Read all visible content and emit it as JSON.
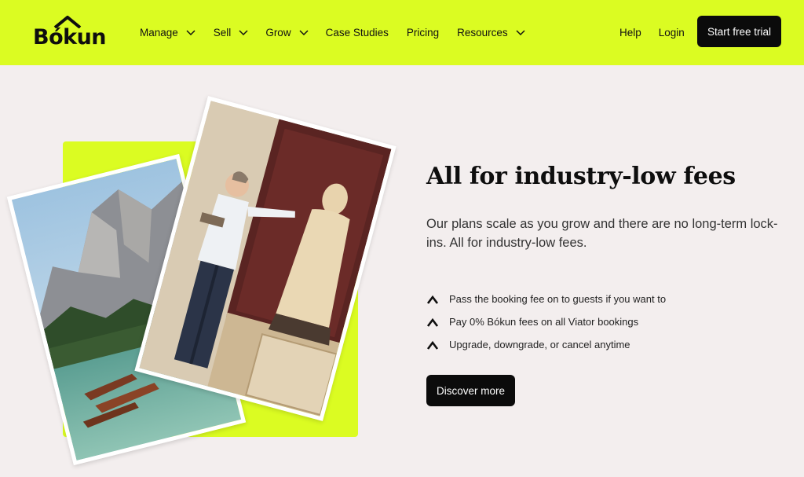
{
  "brand": {
    "name": "Bókun",
    "accent": "#dbfc22",
    "dark": "#0b0b0b",
    "background": "#f3eeee"
  },
  "nav": {
    "items": [
      {
        "label": "Manage",
        "dropdown": true
      },
      {
        "label": "Sell",
        "dropdown": true
      },
      {
        "label": "Grow",
        "dropdown": true
      },
      {
        "label": "Case Studies",
        "dropdown": false
      },
      {
        "label": "Pricing",
        "dropdown": false
      },
      {
        "label": "Resources",
        "dropdown": true
      }
    ],
    "help": "Help",
    "login": "Login",
    "cta": "Start free trial"
  },
  "hero": {
    "headline": "All for industry-low fees",
    "lead": "Our plans scale as you grow and there are no long-term lock-ins. All for industry-low fees.",
    "features": [
      "Pass the booking fee on to guests if you want to",
      "Pay 0% Bókun fees on all Viator bookings",
      "Upgrade, downgrade, or cancel anytime"
    ],
    "cta": "Discover more"
  },
  "icons": {
    "chevron": "chevron-down-icon",
    "feature_bullet": "caret-up-icon",
    "logo_roof": "roof-icon"
  }
}
